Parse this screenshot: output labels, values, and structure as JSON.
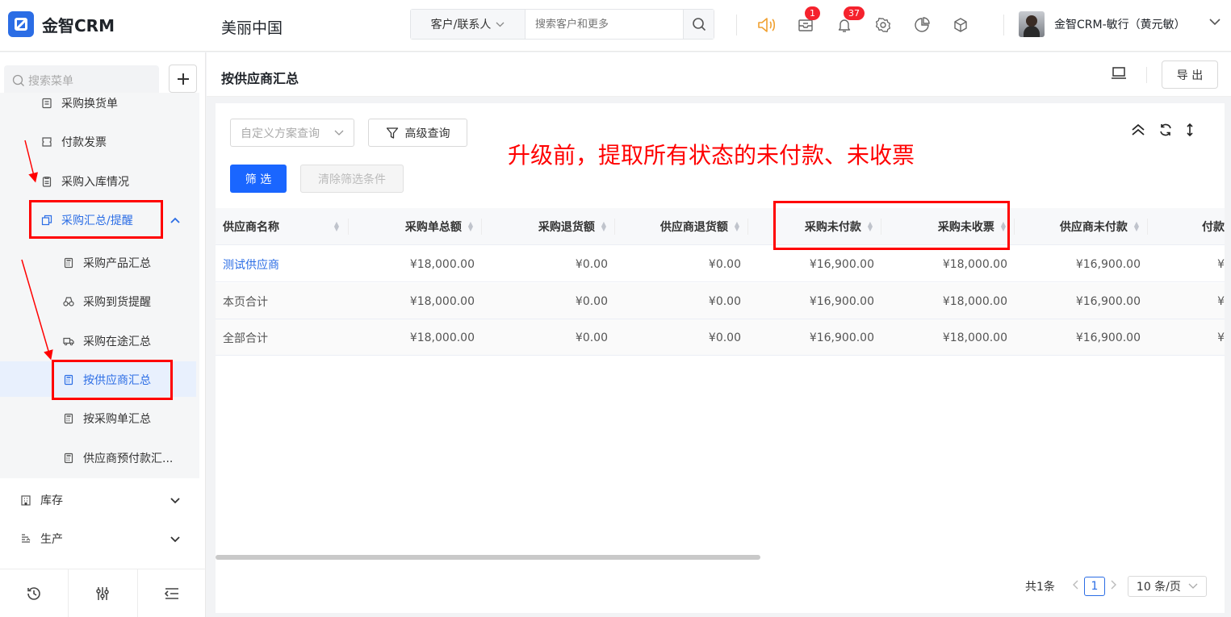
{
  "app": {
    "name": "金智CRM",
    "company": "美丽中国"
  },
  "search": {
    "type_label": "客户/联系人",
    "placeholder": "搜索客户和更多"
  },
  "notifications": {
    "messages_count": "1",
    "alerts_count": "37"
  },
  "user": {
    "name": "金智CRM-敏行（黄元敏）"
  },
  "sidebar": {
    "search_placeholder": "搜索菜单",
    "items": [
      {
        "label": "采购换货单"
      },
      {
        "label": "付款发票"
      },
      {
        "label": "采购入库情况"
      },
      {
        "label": "采购汇总/提醒"
      },
      {
        "label": "采购产品汇总"
      },
      {
        "label": "采购到货提醒"
      },
      {
        "label": "采购在途汇总"
      },
      {
        "label": "按供应商汇总"
      },
      {
        "label": "按采购单汇总"
      },
      {
        "label": "供应商预付款汇..."
      },
      {
        "label": "库存"
      },
      {
        "label": "生产"
      }
    ]
  },
  "page": {
    "title": "按供应商汇总",
    "export_label": "导 出"
  },
  "filters": {
    "scheme_placeholder": "自定义方案查询",
    "advanced_label": "高级查询",
    "filter_label": "筛 选",
    "clear_label": "清除筛选条件"
  },
  "annotation": {
    "text": "升级前，提取所有状态的未付款、未收票"
  },
  "table": {
    "columns": [
      "供应商名称",
      "采购单总额",
      "采购退货额",
      "供应商退货额",
      "采购未付款",
      "采购未收票",
      "供应商未付款",
      "付款"
    ],
    "rows": [
      {
        "name": "测试供应商",
        "cells": [
          "¥18,000.00",
          "¥0.00",
          "¥0.00",
          "¥16,900.00",
          "¥18,000.00",
          "¥16,900.00",
          "¥"
        ]
      },
      {
        "name": "本页合计",
        "cells": [
          "¥18,000.00",
          "¥0.00",
          "¥0.00",
          "¥16,900.00",
          "¥18,000.00",
          "¥16,900.00",
          "¥"
        ]
      },
      {
        "name": "全部合计",
        "cells": [
          "¥18,000.00",
          "¥0.00",
          "¥0.00",
          "¥16,900.00",
          "¥18,000.00",
          "¥16,900.00",
          "¥"
        ]
      }
    ]
  },
  "pagination": {
    "total": "共1条",
    "current_page": "1",
    "page_size": "10 条/页"
  },
  "colors": {
    "primary": "#1a66ff",
    "link": "#2b6de5",
    "annotation": "#ff0000"
  }
}
